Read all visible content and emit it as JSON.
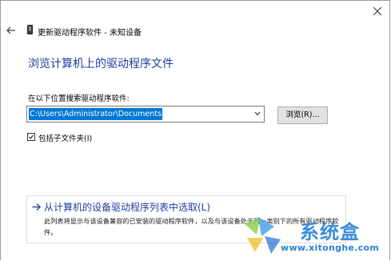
{
  "window": {
    "title": "更新驱动程序软件 - 未知设备"
  },
  "main": {
    "heading": "浏览计算机上的驱动程序文件",
    "search_label": "在以下位置搜索驱动程序软件:",
    "path_value": "C:\\Users\\Administrator\\Documents",
    "browse_label": "浏览(R)...",
    "include_subfolders_label": "包括子文件夹(I)",
    "include_subfolders_checked": true
  },
  "pick_option": {
    "title": "从计算机的设备驱动程序列表中选取(L)",
    "description": "此列表将显示与该设备兼容的已安装的驱动程序软件，以及与该设备处于同一类别下的所有驱动程序软件。"
  },
  "watermark": {
    "brand": "系统盒",
    "site": "www.xitonghe.com"
  },
  "colors": {
    "heading": "#1f3e9e",
    "selection": "#0078d7",
    "button_face": "#e1e1e1"
  }
}
